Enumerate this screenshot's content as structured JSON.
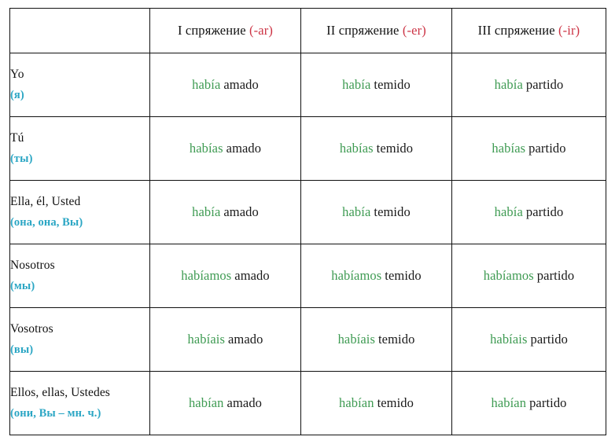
{
  "table": {
    "colors": {
      "ending_red": "#cc3344",
      "russian_cyan": "#2ba6c4",
      "auxiliary_green": "#3f9b53",
      "participle_dark": "#1a1a1a",
      "border": "#111111",
      "background": "#ffffff"
    },
    "header": {
      "corner_label": "",
      "columns": [
        {
          "title": "I спряжение",
          "ending": "(-ar)"
        },
        {
          "title": "II спряжение",
          "ending": "(-er)"
        },
        {
          "title": "III спряжение",
          "ending": "(-ir)"
        }
      ]
    },
    "rows": [
      {
        "pronoun_es": "Yo",
        "pronoun_ru": "(я)",
        "forms": [
          {
            "aux": "había",
            "participle": "amado"
          },
          {
            "aux": "había",
            "participle": "temido"
          },
          {
            "aux": "había",
            "participle": "partido"
          }
        ]
      },
      {
        "pronoun_es": "Tú",
        "pronoun_ru": "(ты)",
        "forms": [
          {
            "aux": "habías",
            "participle": "amado"
          },
          {
            "aux": "habías",
            "participle": "temido"
          },
          {
            "aux": "habías",
            "participle": "partido"
          }
        ]
      },
      {
        "pronoun_es": "Ella, él, Usted",
        "pronoun_ru": "(она, она, Вы)",
        "forms": [
          {
            "aux": "había",
            "participle": "amado"
          },
          {
            "aux": "había",
            "participle": "temido"
          },
          {
            "aux": "había",
            "participle": "partido"
          }
        ]
      },
      {
        "pronoun_es": "Nosotros",
        "pronoun_ru": "(мы)",
        "forms": [
          {
            "aux": "habíamos",
            "participle": "amado"
          },
          {
            "aux": "habíamos",
            "participle": "temido"
          },
          {
            "aux": "habíamos",
            "participle": "partido"
          }
        ]
      },
      {
        "pronoun_es": "Vosotros",
        "pronoun_ru": "(вы)",
        "forms": [
          {
            "aux": "habíais",
            "participle": "amado"
          },
          {
            "aux": "habíais",
            "participle": "temido"
          },
          {
            "aux": "habíais",
            "participle": "partido"
          }
        ]
      },
      {
        "pronoun_es": "Ellos, ellas, Ustedes",
        "pronoun_ru": "(они, Вы – мн. ч.)",
        "forms": [
          {
            "aux": "habían",
            "participle": "amado"
          },
          {
            "aux": "habían",
            "participle": "temido"
          },
          {
            "aux": "habían",
            "participle": "partido"
          }
        ]
      }
    ]
  }
}
